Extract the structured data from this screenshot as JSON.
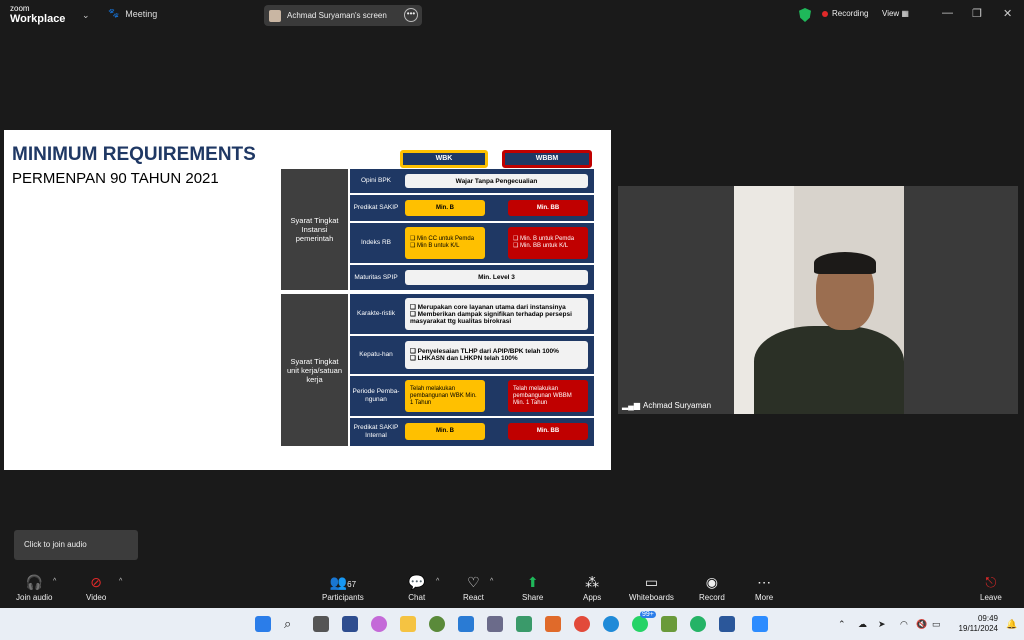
{
  "app": {
    "brand_small": "zoom",
    "brand_name": "Workplace",
    "meeting_label": "Meeting"
  },
  "share_pill": {
    "label": "Achmad Suryaman's screen"
  },
  "status": {
    "recording": "Recording",
    "view": "View"
  },
  "slide": {
    "title": "MINIMUM REQUIREMENTS",
    "subtitle": "PERMENPAN 90 TAHUN 2021",
    "col_wbk": "WBK",
    "col_wbbm": "WBBM",
    "section1": "Syarat Tingkat Instansi pemerintah",
    "section2": "Syarat Tingkat unit kerja/satuan kerja",
    "rows": {
      "opini": {
        "label": "Opini BPK",
        "value": "Wajar Tanpa Pengecualian"
      },
      "predikat": {
        "label": "Predikat SAKIP",
        "wbk": "Min. B",
        "wbbm": "Min. BB"
      },
      "indeks": {
        "label": "Indeks RB",
        "wbk1": "❑ Min CC untuk Pemda",
        "wbk2": "❑ Min B untuk K/L",
        "wbbm1": "❑ Min. B untuk Pemda",
        "wbbm2": "❑ Min. BB untuk K/L"
      },
      "maturitas": {
        "label": "Maturitas SPIP",
        "value": "Min. Level 3"
      },
      "karakteristik": {
        "label": "Karakte-ristik",
        "l1": "❑ Merupakan core layanan utama dari instansinya",
        "l2": "❑ Memberikan dampak signifikan terhadap persepsi masyarakat ttg kualitas birokrasi"
      },
      "kepatuhan": {
        "label": "Kepatu-han",
        "l1": "❑ Penyelesaian TLHP dari APIP/BPK telah 100%",
        "l2": "❑ LHKASN dan LHKPN telah 100%"
      },
      "periode": {
        "label": "Periode Pemba-ngunan",
        "wbk": "Telah melakukan pembangunan WBK Min. 1 Tahun",
        "wbbm": "Telah melakukan pembangunan WBBM Min. 1 Tahun"
      },
      "sakip_internal": {
        "label": "Predikat SAKIP Internal",
        "wbk": "Min. B",
        "wbbm": "Min. BB"
      }
    }
  },
  "camera": {
    "name": "Achmad Suryaman"
  },
  "tooltip": "Click to join audio",
  "toolbar": {
    "join_audio": "Join audio",
    "video": "Video",
    "participants": "Participants",
    "participants_count": "67",
    "chat": "Chat",
    "react": "React",
    "share": "Share",
    "apps": "Apps",
    "whiteboards": "Whiteboards",
    "record": "Record",
    "more": "More",
    "leave": "Leave"
  },
  "taskbar": {
    "time": "09:49",
    "date": "19/11/2024",
    "badge": "99+"
  },
  "colors": {
    "accent_green": "#1fb85a",
    "record_red": "#e02929",
    "slide_navy": "#1f3864",
    "wbk_yellow": "#ffc000",
    "wbbm_red": "#c00000"
  }
}
